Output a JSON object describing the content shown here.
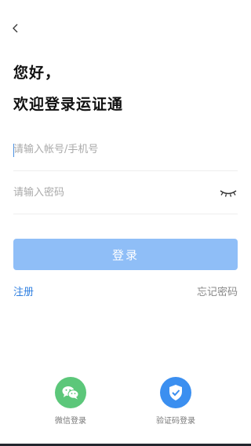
{
  "nav": {
    "back_icon": "chevron-left-icon"
  },
  "greeting": "您好，",
  "welcome": "欢迎登录运证通",
  "account": {
    "placeholder": "请输入帐号/手机号",
    "value": ""
  },
  "password": {
    "placeholder": "请输入密码",
    "value": "",
    "toggle_icon": "eye-closed-icon"
  },
  "login_button": {
    "label": "登录",
    "enabled": false
  },
  "links": {
    "register": "注册",
    "forgot": "忘记密码"
  },
  "alt_logins": [
    {
      "label": "微信登录",
      "icon": "wechat-icon",
      "color": "#5cc77a"
    },
    {
      "label": "验证码登录",
      "icon": "shield-check-icon",
      "color": "#3b8ff0"
    }
  ],
  "colors": {
    "accent": "#2f7fe0",
    "button_disabled": "#8fbef7",
    "wechat_green": "#5cc77a",
    "sms_blue": "#3b8ff0"
  }
}
